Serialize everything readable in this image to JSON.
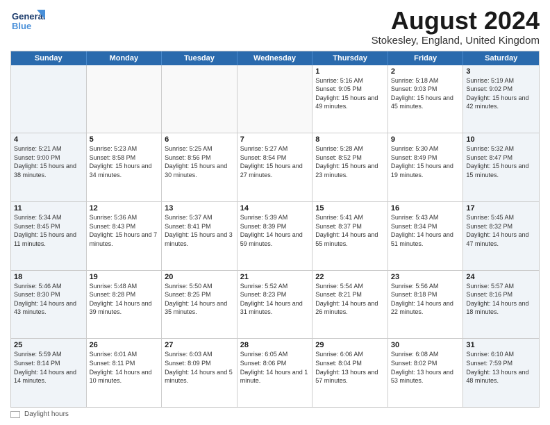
{
  "header": {
    "logo_general": "General",
    "logo_blue": "Blue",
    "month_title": "August 2024",
    "location": "Stokesley, England, United Kingdom"
  },
  "days_of_week": [
    "Sunday",
    "Monday",
    "Tuesday",
    "Wednesday",
    "Thursday",
    "Friday",
    "Saturday"
  ],
  "footer": {
    "daylight_label": "Daylight hours"
  },
  "weeks": [
    [
      {
        "day": "",
        "info": ""
      },
      {
        "day": "",
        "info": ""
      },
      {
        "day": "",
        "info": ""
      },
      {
        "day": "",
        "info": ""
      },
      {
        "day": "1",
        "info": "Sunrise: 5:16 AM\nSunset: 9:05 PM\nDaylight: 15 hours\nand 49 minutes."
      },
      {
        "day": "2",
        "info": "Sunrise: 5:18 AM\nSunset: 9:03 PM\nDaylight: 15 hours\nand 45 minutes."
      },
      {
        "day": "3",
        "info": "Sunrise: 5:19 AM\nSunset: 9:02 PM\nDaylight: 15 hours\nand 42 minutes."
      }
    ],
    [
      {
        "day": "4",
        "info": "Sunrise: 5:21 AM\nSunset: 9:00 PM\nDaylight: 15 hours\nand 38 minutes."
      },
      {
        "day": "5",
        "info": "Sunrise: 5:23 AM\nSunset: 8:58 PM\nDaylight: 15 hours\nand 34 minutes."
      },
      {
        "day": "6",
        "info": "Sunrise: 5:25 AM\nSunset: 8:56 PM\nDaylight: 15 hours\nand 30 minutes."
      },
      {
        "day": "7",
        "info": "Sunrise: 5:27 AM\nSunset: 8:54 PM\nDaylight: 15 hours\nand 27 minutes."
      },
      {
        "day": "8",
        "info": "Sunrise: 5:28 AM\nSunset: 8:52 PM\nDaylight: 15 hours\nand 23 minutes."
      },
      {
        "day": "9",
        "info": "Sunrise: 5:30 AM\nSunset: 8:49 PM\nDaylight: 15 hours\nand 19 minutes."
      },
      {
        "day": "10",
        "info": "Sunrise: 5:32 AM\nSunset: 8:47 PM\nDaylight: 15 hours\nand 15 minutes."
      }
    ],
    [
      {
        "day": "11",
        "info": "Sunrise: 5:34 AM\nSunset: 8:45 PM\nDaylight: 15 hours\nand 11 minutes."
      },
      {
        "day": "12",
        "info": "Sunrise: 5:36 AM\nSunset: 8:43 PM\nDaylight: 15 hours\nand 7 minutes."
      },
      {
        "day": "13",
        "info": "Sunrise: 5:37 AM\nSunset: 8:41 PM\nDaylight: 15 hours\nand 3 minutes."
      },
      {
        "day": "14",
        "info": "Sunrise: 5:39 AM\nSunset: 8:39 PM\nDaylight: 14 hours\nand 59 minutes."
      },
      {
        "day": "15",
        "info": "Sunrise: 5:41 AM\nSunset: 8:37 PM\nDaylight: 14 hours\nand 55 minutes."
      },
      {
        "day": "16",
        "info": "Sunrise: 5:43 AM\nSunset: 8:34 PM\nDaylight: 14 hours\nand 51 minutes."
      },
      {
        "day": "17",
        "info": "Sunrise: 5:45 AM\nSunset: 8:32 PM\nDaylight: 14 hours\nand 47 minutes."
      }
    ],
    [
      {
        "day": "18",
        "info": "Sunrise: 5:46 AM\nSunset: 8:30 PM\nDaylight: 14 hours\nand 43 minutes."
      },
      {
        "day": "19",
        "info": "Sunrise: 5:48 AM\nSunset: 8:28 PM\nDaylight: 14 hours\nand 39 minutes."
      },
      {
        "day": "20",
        "info": "Sunrise: 5:50 AM\nSunset: 8:25 PM\nDaylight: 14 hours\nand 35 minutes."
      },
      {
        "day": "21",
        "info": "Sunrise: 5:52 AM\nSunset: 8:23 PM\nDaylight: 14 hours\nand 31 minutes."
      },
      {
        "day": "22",
        "info": "Sunrise: 5:54 AM\nSunset: 8:21 PM\nDaylight: 14 hours\nand 26 minutes."
      },
      {
        "day": "23",
        "info": "Sunrise: 5:56 AM\nSunset: 8:18 PM\nDaylight: 14 hours\nand 22 minutes."
      },
      {
        "day": "24",
        "info": "Sunrise: 5:57 AM\nSunset: 8:16 PM\nDaylight: 14 hours\nand 18 minutes."
      }
    ],
    [
      {
        "day": "25",
        "info": "Sunrise: 5:59 AM\nSunset: 8:14 PM\nDaylight: 14 hours\nand 14 minutes."
      },
      {
        "day": "26",
        "info": "Sunrise: 6:01 AM\nSunset: 8:11 PM\nDaylight: 14 hours\nand 10 minutes."
      },
      {
        "day": "27",
        "info": "Sunrise: 6:03 AM\nSunset: 8:09 PM\nDaylight: 14 hours\nand 5 minutes."
      },
      {
        "day": "28",
        "info": "Sunrise: 6:05 AM\nSunset: 8:06 PM\nDaylight: 14 hours\nand 1 minute."
      },
      {
        "day": "29",
        "info": "Sunrise: 6:06 AM\nSunset: 8:04 PM\nDaylight: 13 hours\nand 57 minutes."
      },
      {
        "day": "30",
        "info": "Sunrise: 6:08 AM\nSunset: 8:02 PM\nDaylight: 13 hours\nand 53 minutes."
      },
      {
        "day": "31",
        "info": "Sunrise: 6:10 AM\nSunset: 7:59 PM\nDaylight: 13 hours\nand 48 minutes."
      }
    ]
  ]
}
